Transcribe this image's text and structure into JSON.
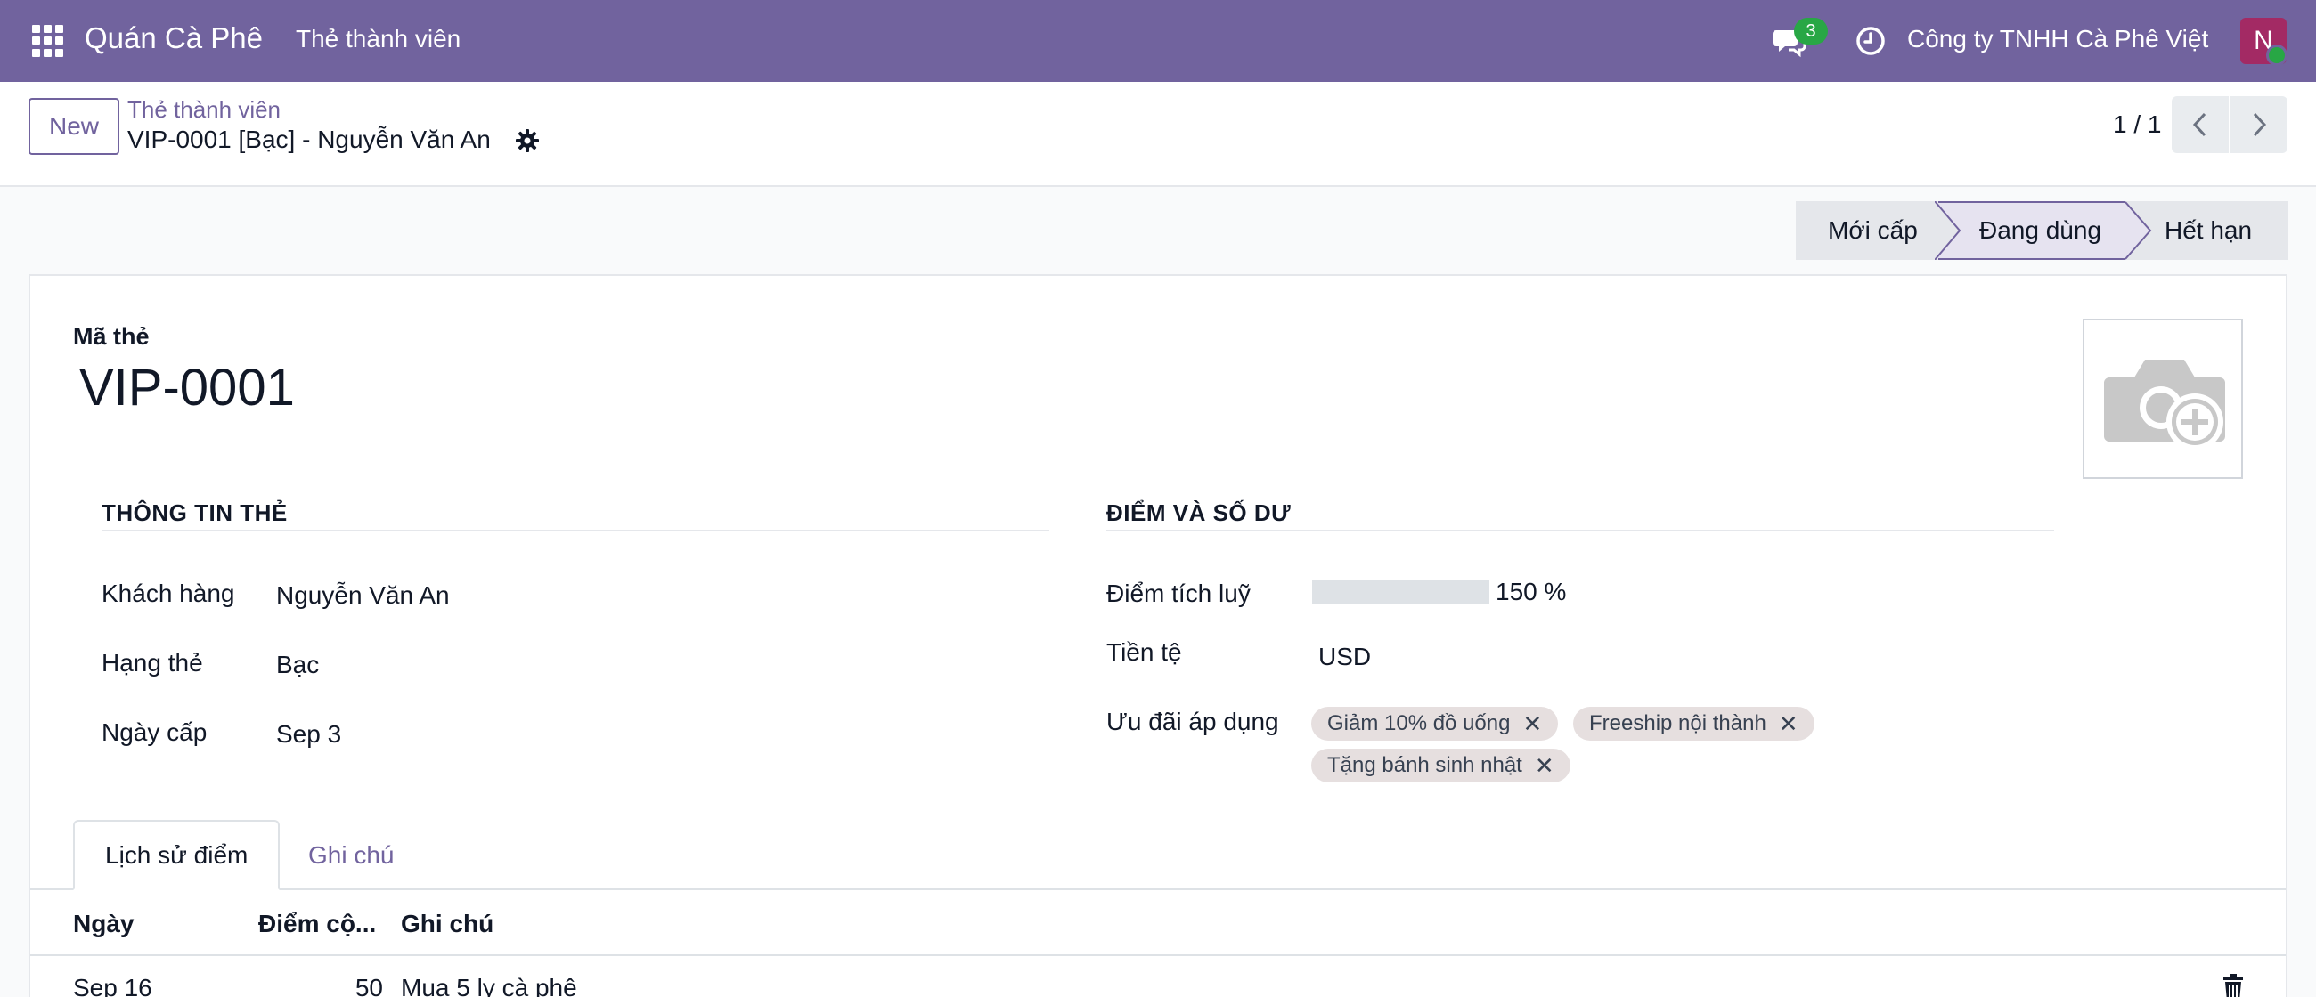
{
  "navbar": {
    "brand": "Quán Cà Phê",
    "menu_item": "Thẻ thành viên",
    "chat_count": "3",
    "company": "Công ty TNHH Cà Phê Việt",
    "avatar_initial": "N",
    "color": "#71639e"
  },
  "control": {
    "new_label": "New",
    "breadcrumb_parent": "Thẻ thành viên",
    "breadcrumb_current": "VIP-0001 [Bạc] - Nguyễn Văn An",
    "pager": "1 / 1"
  },
  "status": {
    "stages": [
      "Mới cấp",
      "Đang dùng",
      "Hết hạn"
    ],
    "active": "Đang dùng"
  },
  "form": {
    "code_label": "Mã thẻ",
    "code_value": "VIP-0001",
    "left_section": {
      "title": "THÔNG TIN THẺ",
      "fields": [
        {
          "label": "Khách hàng",
          "value": "Nguyễn Văn An"
        },
        {
          "label": "Hạng thẻ",
          "value": "Bạc"
        },
        {
          "label": "Ngày cấp",
          "value": "Sep 3"
        }
      ]
    },
    "right_section": {
      "title": "ĐIỂM VÀ SỐ DƯ",
      "points_label": "Điểm tích luỹ",
      "points_value": "150 %",
      "currency_label": "Tiền tệ",
      "currency_value": "USD",
      "perks_label": "Ưu đãi áp dụng",
      "perks": [
        "Giảm 10% đồ uống",
        "Freeship nội thành",
        "Tặng bánh sinh nhật"
      ]
    }
  },
  "tabs": [
    "Lịch sử điểm",
    "Ghi chú"
  ],
  "table": {
    "headers": [
      "Ngày",
      "Điểm cộ...",
      "Ghi chú"
    ],
    "rows": [
      {
        "date": "Sep 16",
        "points": "50",
        "note": "Mua 5 ly cà phê"
      }
    ]
  }
}
